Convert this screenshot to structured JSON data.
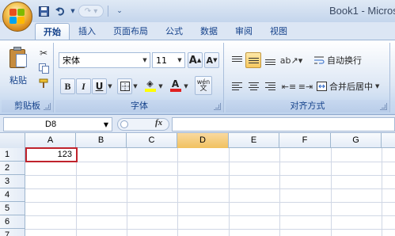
{
  "window": {
    "title": "Book1 - Micros"
  },
  "tabs": [
    "开始",
    "插入",
    "页面布局",
    "公式",
    "数据",
    "审阅",
    "视图"
  ],
  "clipboard": {
    "paste_label": "粘贴",
    "group_label": "剪贴板"
  },
  "font": {
    "name": "宋体",
    "size": "11",
    "grow": "A",
    "shrink": "A",
    "bold": "B",
    "italic": "I",
    "underline": "U",
    "font_color_letter": "A",
    "wen": "wén",
    "group_label": "字体"
  },
  "alignment": {
    "wrap_label": "自动换行",
    "merge_label": "合并后居中",
    "group_label": "对齐方式"
  },
  "formula_bar": {
    "name_box": "D8",
    "fx": "fx",
    "formula": ""
  },
  "grid": {
    "columns": [
      "A",
      "B",
      "C",
      "D",
      "E",
      "F",
      "G"
    ],
    "rows": [
      "1",
      "2",
      "3",
      "4",
      "5",
      "6",
      "7"
    ],
    "selected_column": "D",
    "cells": {
      "A1": "123"
    }
  },
  "colors": {
    "highlight": "#c0232c",
    "font_color_bar": "#e02020",
    "fill_color_bar": "#ffff00"
  }
}
